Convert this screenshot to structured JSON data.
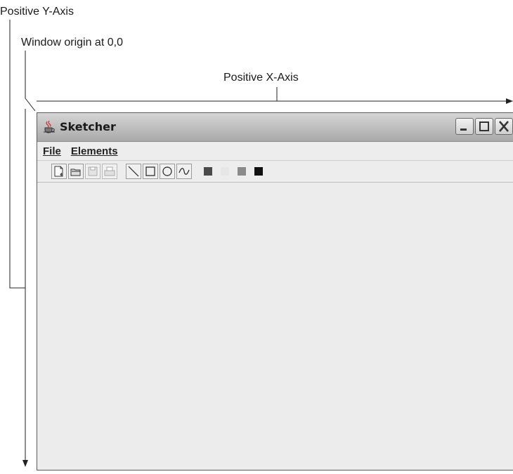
{
  "annotations": {
    "y_axis": "Positive Y-Axis",
    "origin": "Window origin at 0,0",
    "x_axis": "Positive X-Axis"
  },
  "window": {
    "title": "Sketcher",
    "app_icon": "java-cup-icon",
    "controls": [
      "minimize-icon",
      "maximize-icon",
      "close-icon"
    ]
  },
  "menubar": {
    "items": [
      "File",
      "Elements"
    ]
  },
  "toolbar": {
    "file_tools": [
      "new-file-icon",
      "open-file-icon",
      "save-icon",
      "print-icon"
    ],
    "element_tools": [
      "line-icon",
      "rectangle-icon",
      "circle-icon",
      "curve-icon"
    ],
    "color_tools": [
      "red-color-icon",
      "yellow-color-icon",
      "green-color-icon",
      "blue-color-icon"
    ]
  },
  "colors": {
    "red": "#4a4a4a",
    "yellow": "#e6e6e6",
    "green": "#8a8a8a",
    "blue": "#111111"
  }
}
